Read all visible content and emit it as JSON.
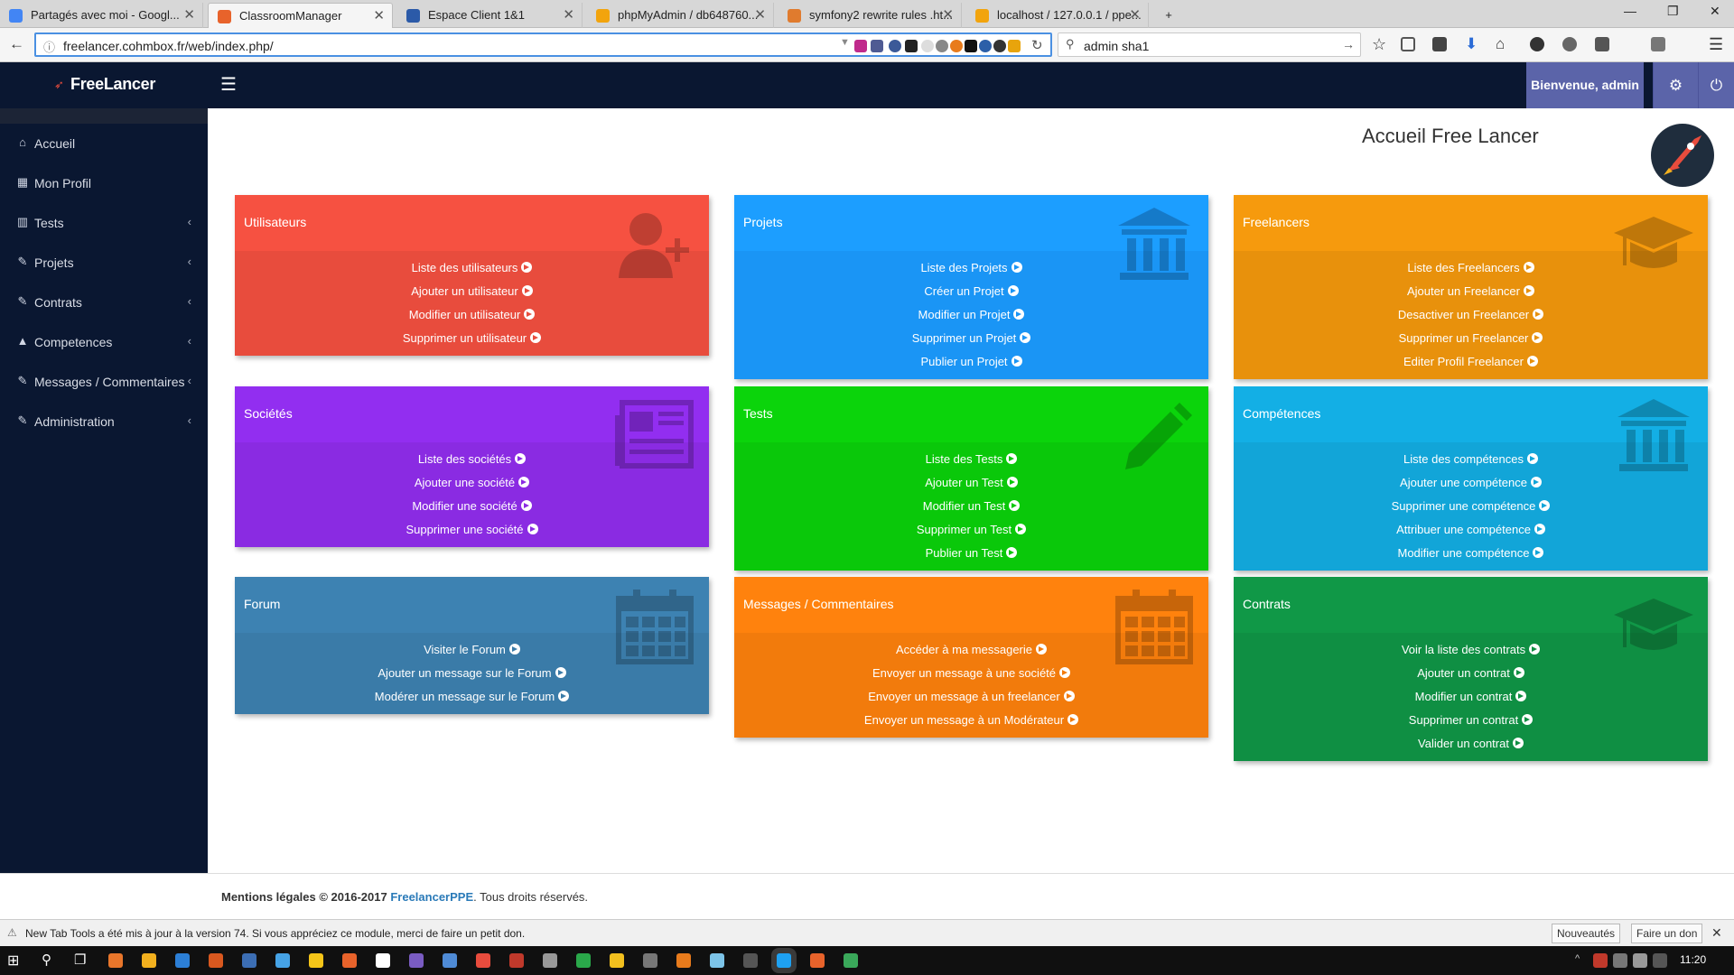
{
  "browser": {
    "tabs": [
      {
        "label": "Partagés avec moi - Googl...",
        "color": "#4285f4"
      },
      {
        "label": "ClassroomManager",
        "color": "#e8632b"
      },
      {
        "label": "Espace Client 1&1",
        "color": "#2b5aa8"
      },
      {
        "label": "phpMyAdmin / db648760...",
        "color": "#f2a40d"
      },
      {
        "label": "symfony2 rewrite rules .ht...",
        "color": "#e07b2e"
      },
      {
        "label": "localhost / 127.0.0.1 / ppe...",
        "color": "#f2a40d"
      }
    ],
    "new_tab": "+",
    "url": "freelancer.cohmbox.fr/web/index.php/",
    "search_query": "admin sha1"
  },
  "app": {
    "brand": "FreeLancer",
    "welcome": "Bienvenue, admin",
    "page_title": "Accueil Free Lancer"
  },
  "sidebar": {
    "items": [
      {
        "label": "Accueil",
        "icon": "home-icon",
        "glyph": "⌂",
        "chevron": ""
      },
      {
        "label": "Mon Profil",
        "icon": "calendar-icon",
        "glyph": "▦",
        "chevron": ""
      },
      {
        "label": "Tests",
        "icon": "bank-icon",
        "glyph": "▥",
        "chevron": "‹"
      },
      {
        "label": "Projets",
        "icon": "pencil-icon",
        "glyph": "✎",
        "chevron": "‹"
      },
      {
        "label": "Contrats",
        "icon": "wrench-icon",
        "glyph": "✎",
        "chevron": "‹"
      },
      {
        "label": "Competences",
        "icon": "graduation-cap-icon",
        "glyph": "▲",
        "chevron": "‹"
      },
      {
        "label": "Messages / Commentaires",
        "icon": "wrench-icon",
        "glyph": "✎",
        "chevron": "‹"
      },
      {
        "label": "Administration",
        "icon": "wrench-icon",
        "glyph": "✎",
        "chevron": "‹"
      }
    ]
  },
  "cards": [
    {
      "title": "Utilisateurs",
      "color": "#e84c3d",
      "icon": "add-user-icon",
      "links": [
        "Liste des utilisateurs",
        "Ajouter un utilisateur",
        "Modifier un utilisateur",
        "Supprimer un utilisateur"
      ]
    },
    {
      "title": "Projets",
      "color": "#1a95f5",
      "icon": "bank-icon",
      "links": [
        "Liste des Projets",
        "Créer un Projet",
        "Modifier un Projet",
        "Supprimer un Projet",
        "Publier un Projet"
      ]
    },
    {
      "title": "Freelancers",
      "color": "#e8910c",
      "icon": "graduation-cap-icon",
      "links": [
        "Liste des Freelancers",
        "Ajouter un Freelancer",
        "Desactiver un Freelancer",
        "Supprimer un Freelancer",
        "Editer Profil Freelancer"
      ]
    },
    {
      "title": "Sociétés",
      "color": "#8a2be2",
      "icon": "newspaper-icon",
      "links": [
        "Liste des sociétés",
        "Ajouter une société",
        "Modifier une société",
        "Supprimer une société"
      ]
    },
    {
      "title": "Tests",
      "color": "#0ac80a",
      "icon": "pencil-icon",
      "links": [
        "Liste des Tests",
        "Ajouter un Test",
        "Modifier un Test",
        "Supprimer un Test",
        "Publier un Test"
      ]
    },
    {
      "title": "Compétences",
      "color": "#12a5d8",
      "icon": "bank-icon",
      "links": [
        "Liste des compétences",
        "Ajouter une compétence",
        "Supprimer une compétence",
        "Attribuer une compétence",
        "Modifier une compétence"
      ]
    },
    {
      "title": "Forum",
      "color": "#3a7ba8",
      "icon": "calendar-icon",
      "links": [
        "Visiter le Forum",
        "Ajouter un message sur le Forum",
        "Modérer un message sur le Forum"
      ]
    },
    {
      "title": "Messages / Commentaires",
      "color": "#f27b0c",
      "icon": "calendar-icon",
      "links": [
        "Accéder à ma messagerie",
        "Envoyer un message à une société",
        "Envoyer un message à un freelancer",
        "Envoyer un message à un Modérateur"
      ]
    },
    {
      "title": "Contrats",
      "color": "#0f8f43",
      "icon": "graduation-cap-icon",
      "links": [
        "Voir la liste des contrats",
        "Ajouter un contrat",
        "Modifier un contrat",
        "Supprimer un contrat",
        "Valider un contrat"
      ]
    }
  ],
  "footer": {
    "prefix": "Mentions légales © 2016-2017 ",
    "brand": "FreelancerPPE",
    "suffix": ". Tous droits réservés."
  },
  "notification": {
    "text": "New Tab Tools a été mis à jour à la version 74. Si vous appréciez ce module, merci de faire un petit don.",
    "btn1": "Nouveautés",
    "btn2": "Faire un don"
  },
  "taskbar": {
    "clock": "11:20"
  }
}
